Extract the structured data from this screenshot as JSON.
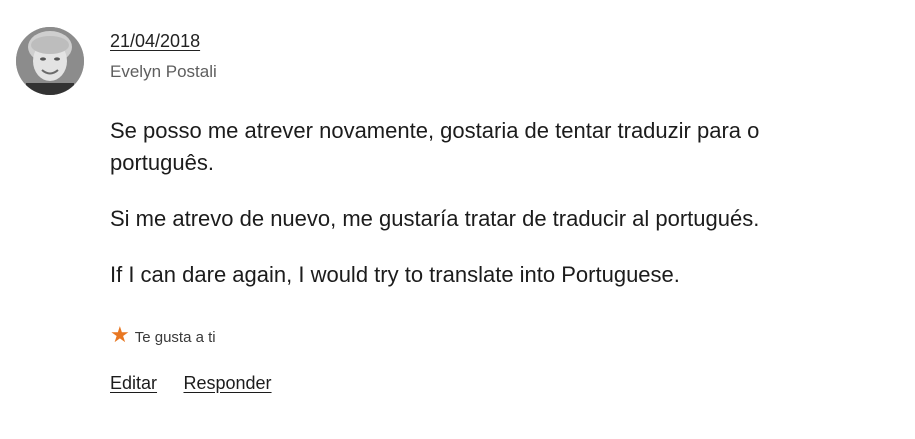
{
  "comment": {
    "date": "21/04/2018",
    "author": "Evelyn Postali",
    "paragraphs": [
      "Se posso me atrever novamente, gostaria de tentar traduzir para o português.",
      "Si me atrevo de nuevo, me gustaría tratar de traducir al portugués.",
      "If I can dare again, I would try to translate into Portuguese."
    ],
    "like_icon": "star-icon",
    "like_text": "Te gusta a ti",
    "accent_color": "#e87722",
    "actions": {
      "edit_label": "Editar",
      "reply_label": "Responder"
    }
  }
}
